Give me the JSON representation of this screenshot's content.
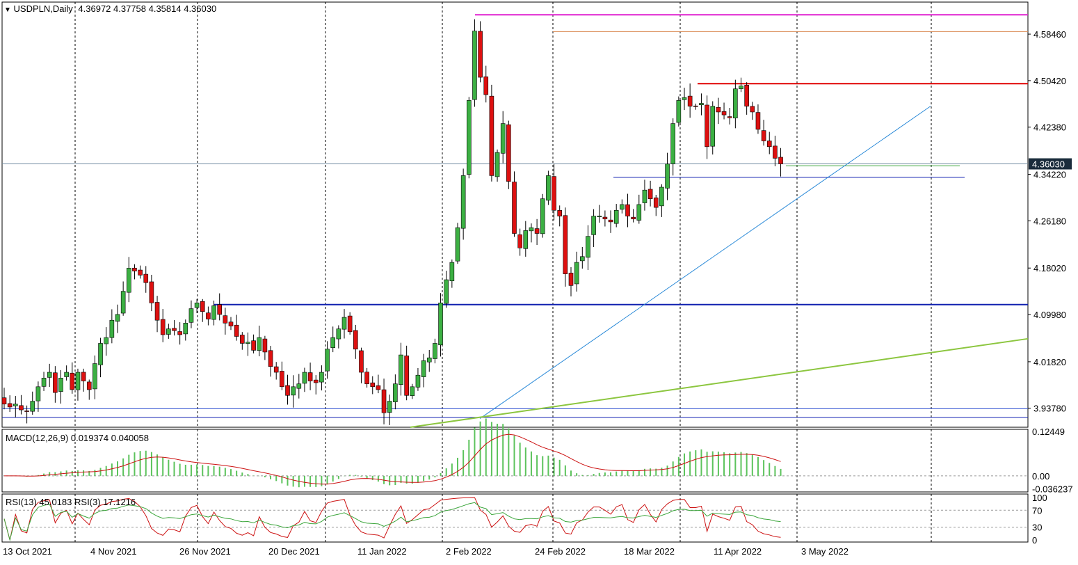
{
  "header": {
    "symbol": "USDPLN,Daily",
    "ohlc": "4.36972 4.37758 4.35814 4.36030"
  },
  "macd_label": "MACD(12,26,9) 0.019374 0.040058",
  "rsi_label": "RSI(13) 45.0183  RSI(3) 17.1216",
  "colors": {
    "bull": "#3cb043",
    "bear": "#dd1010",
    "price_line": "#6f8aa0",
    "resistance_magenta": "#e020d0",
    "resistance_orange": "#d98850",
    "resistance_red": "#e00000",
    "support_blue": "#1020b0",
    "trend_blue": "#2a8ad8",
    "trend_green": "#8cc63f",
    "macd_hist": "#5cc35c",
    "macd_signal": "#cc1010",
    "rsi13": "#3aa53a",
    "rsi3": "#cc1010"
  },
  "chart_data": [
    {
      "type": "candlestick",
      "instrument": "USDPLN",
      "timeframe": "Daily",
      "ylim": [
        3.905,
        4.64
      ],
      "y_ticks": [
        "4.58460",
        "4.50420",
        "4.42380",
        "4.34220",
        "4.26180",
        "4.18020",
        "4.09980",
        "4.01820",
        "3.93780"
      ],
      "x_ticks": [
        "13 Oct 2021",
        "4 Nov 2021",
        "26 Nov 2021",
        "20 Dec 2021",
        "11 Jan 2022",
        "2 Feb 2022",
        "24 Feb 2022",
        "18 Mar 2022",
        "11 Apr 2022",
        "3 May 2022"
      ],
      "current_price_label": "4.36030",
      "current_price": 4.3603,
      "closes": [
        3.945,
        3.94,
        3.945,
        3.935,
        3.932,
        3.95,
        3.975,
        3.99,
        4.0,
        3.965,
        3.99,
        4.0,
        3.97,
        4.0,
        3.985,
        3.97,
        4.015,
        4.05,
        4.06,
        4.09,
        4.1,
        4.14,
        4.18,
        4.175,
        4.168,
        4.155,
        4.12,
        4.09,
        4.065,
        4.075,
        4.072,
        4.065,
        4.085,
        4.11,
        4.12,
        4.105,
        4.092,
        4.115,
        4.1,
        4.085,
        4.08,
        4.062,
        4.05,
        4.052,
        4.038,
        4.06,
        4.035,
        4.01,
        4.0,
        3.975,
        3.96,
        3.975,
        3.98,
        4.0,
        3.985,
        3.982,
        4.0,
        4.04,
        4.06,
        4.075,
        4.095,
        4.07,
        4.04,
        4.0,
        3.98,
        3.975,
        3.97,
        3.93,
        3.95,
        3.98,
        4.03,
        3.96,
        3.975,
        3.995,
        4.02,
        4.025,
        4.05,
        4.12,
        4.16,
        4.19,
        4.25,
        4.34,
        4.47,
        4.59,
        4.51,
        4.48,
        4.34,
        4.38,
        4.43,
        4.33,
        4.24,
        4.215,
        4.245,
        4.25,
        4.24,
        4.3,
        4.34,
        4.28,
        4.27,
        4.17,
        4.15,
        4.19,
        4.2,
        4.235,
        4.27,
        4.27,
        4.265,
        4.26,
        4.28,
        4.29,
        4.27,
        4.265,
        4.29,
        4.315,
        4.3,
        4.285,
        4.32,
        4.36,
        4.43,
        4.47,
        4.475,
        4.46,
        4.46,
        4.465,
        4.39,
        4.46,
        4.45,
        4.445,
        4.44,
        4.49,
        4.495,
        4.46,
        4.45,
        4.42,
        4.4,
        4.39,
        4.37,
        4.3603
      ]
    },
    {
      "type": "bar",
      "indicator": "MACD(12,26,9)",
      "main": 0.019374,
      "signal": 0.040058,
      "ylim": [
        -0.045,
        0.13
      ],
      "y_ticks": [
        "0.12449",
        "0.00",
        "-0.036237"
      ]
    },
    {
      "type": "line",
      "indicator": "RSI",
      "series": [
        {
          "name": "RSI(13)",
          "last": 45.0183
        },
        {
          "name": "RSI(3)",
          "last": 17.1216
        }
      ],
      "ylim": [
        0,
        100
      ],
      "y_ticks": [
        "100",
        "70",
        "30",
        "0"
      ]
    }
  ]
}
